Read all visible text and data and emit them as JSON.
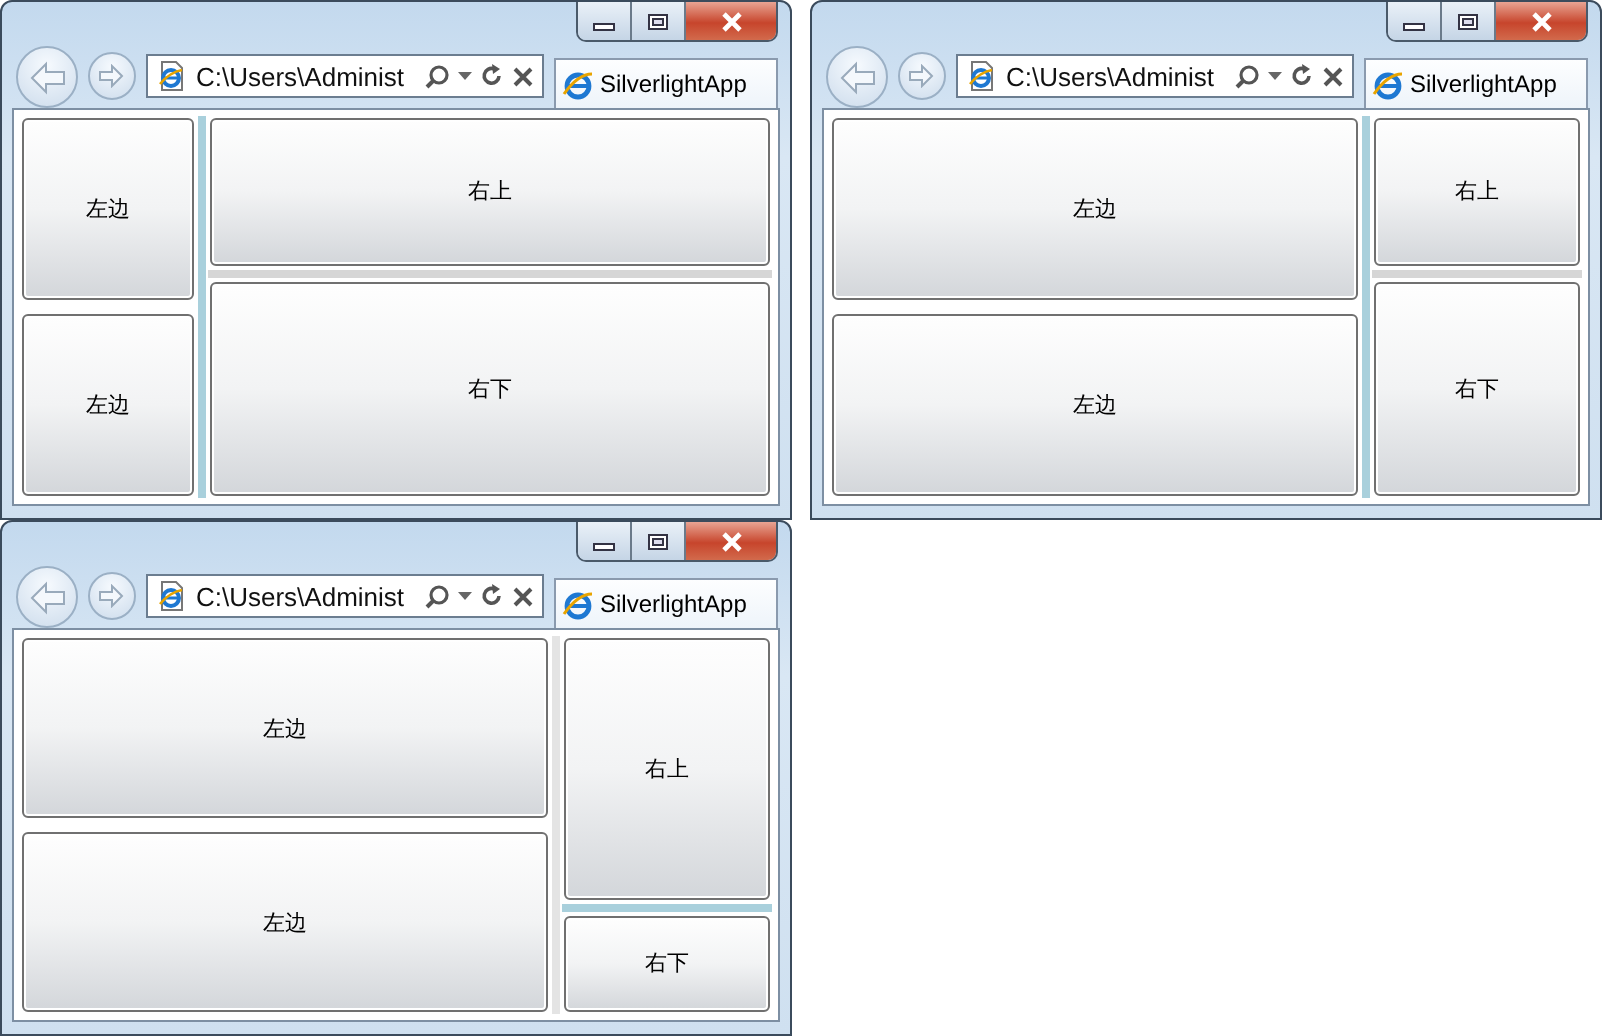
{
  "windows": [
    {
      "address": "C:\\Users\\Administ",
      "tab": "SilverlightApp",
      "left_panes": [
        "左边",
        "左边"
      ],
      "right_panes": [
        "右上",
        "右下"
      ],
      "vertical_splitter": {
        "focused": true
      },
      "horizontal_splitter": {
        "focused": false
      }
    },
    {
      "address": "C:\\Users\\Administ",
      "tab": "SilverlightApp",
      "left_panes": [
        "左边",
        "左边"
      ],
      "right_panes": [
        "右上",
        "右下"
      ],
      "vertical_splitter": {
        "focused": true
      },
      "horizontal_splitter": {
        "focused": false
      }
    },
    {
      "address": "C:\\Users\\Administ",
      "tab": "SilverlightApp",
      "left_panes": [
        "左边",
        "左边"
      ],
      "right_panes": [
        "右上",
        "右下"
      ],
      "vertical_splitter": {
        "focused": false
      },
      "horizontal_splitter": {
        "focused": true
      }
    }
  ]
}
